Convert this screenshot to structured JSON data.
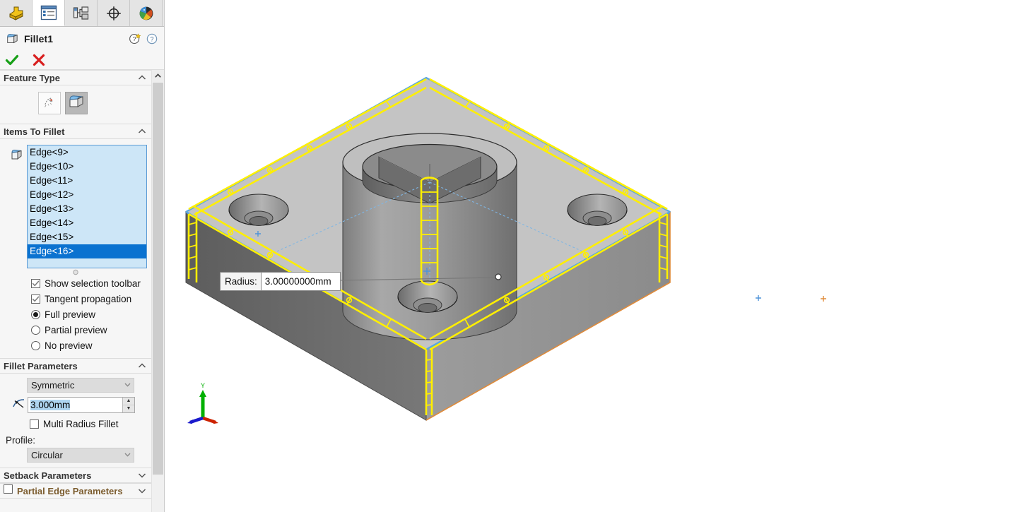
{
  "tabs": [
    {
      "name": "feature-manager-design-tree",
      "icon": "yellow-feature-tree-icon",
      "active": false
    },
    {
      "name": "property-manager",
      "icon": "property-list-icon",
      "active": true
    },
    {
      "name": "configuration-manager",
      "icon": "configuration-tree-icon",
      "active": false
    },
    {
      "name": "dimxpert-manager",
      "icon": "crosshair-target-icon",
      "active": false
    },
    {
      "name": "display-manager",
      "icon": "color-globe-icon",
      "active": false
    }
  ],
  "property_manager": {
    "title": "Fillet1",
    "title_icon": "fillet-feature-icon",
    "whats_new_label": "?",
    "help_label": "?",
    "ok_glyph": "✔",
    "cancel_glyph": "✖"
  },
  "feature_type": {
    "header": "Feature Type",
    "collapse_glyph": "⌃",
    "buttons": [
      {
        "name": "manual-fillet-button",
        "icon": "manual-sketch-icon",
        "pressed": false
      },
      {
        "name": "fillet-xpert-button",
        "icon": "fillet-block-icon",
        "pressed": true
      }
    ]
  },
  "items_to_fillet": {
    "header": "Items To Fillet",
    "collapse_glyph": "⌃",
    "selection_icon": "edge-selection-icon",
    "edges": [
      {
        "label": "Edge<9>",
        "selected": false
      },
      {
        "label": "Edge<10>",
        "selected": false
      },
      {
        "label": "Edge<11>",
        "selected": false
      },
      {
        "label": "Edge<12>",
        "selected": false
      },
      {
        "label": "Edge<13>",
        "selected": false
      },
      {
        "label": "Edge<14>",
        "selected": false
      },
      {
        "label": "Edge<15>",
        "selected": false
      },
      {
        "label": "Edge<16>",
        "selected": true
      }
    ],
    "options": [
      {
        "type": "checkbox",
        "label": "Show selection toolbar",
        "checked": true
      },
      {
        "type": "checkbox",
        "label": "Tangent propagation",
        "checked": true
      },
      {
        "type": "radio",
        "label": "Full preview",
        "checked": true
      },
      {
        "type": "radio",
        "label": "Partial preview",
        "checked": false
      },
      {
        "type": "radio",
        "label": "No preview",
        "checked": false
      }
    ]
  },
  "fillet_parameters": {
    "header": "Fillet Parameters",
    "collapse_glyph": "⌃",
    "symmetry_value": "Symmetric",
    "radius_icon": "radius-arc-icon",
    "radius_value": "3.000mm",
    "multi_radius": {
      "label": "Multi Radius Fillet",
      "checked": false
    },
    "profile_label": "Profile:",
    "profile_value": "Circular",
    "spin_up_glyph": "▲",
    "spin_down_glyph": "▼"
  },
  "setback_parameters": {
    "header": "Setback Parameters",
    "expand_glyph": "⌄"
  },
  "partial_edge_parameters": {
    "header": "Partial Edge Parameters",
    "expand_glyph": "⌄",
    "checked": false
  },
  "viewport": {
    "callout": {
      "key": "Radius:",
      "value": "3.00000000mm"
    },
    "triad": {
      "y_label": "Y",
      "x_color": "#cc2200",
      "y_color": "#00b000",
      "z_color": "#1a1acc"
    },
    "origin_marker": "+",
    "colors": {
      "preview_highlight": "#ffef00",
      "selected_edge": "#5aa7e0",
      "face_top": "#c2c2c2",
      "face_front_dark": "#6e6e6e",
      "face_front": "#9a9a9a",
      "boss_light": "#bdbdbd",
      "orange_edge": "#e08b3a"
    }
  }
}
